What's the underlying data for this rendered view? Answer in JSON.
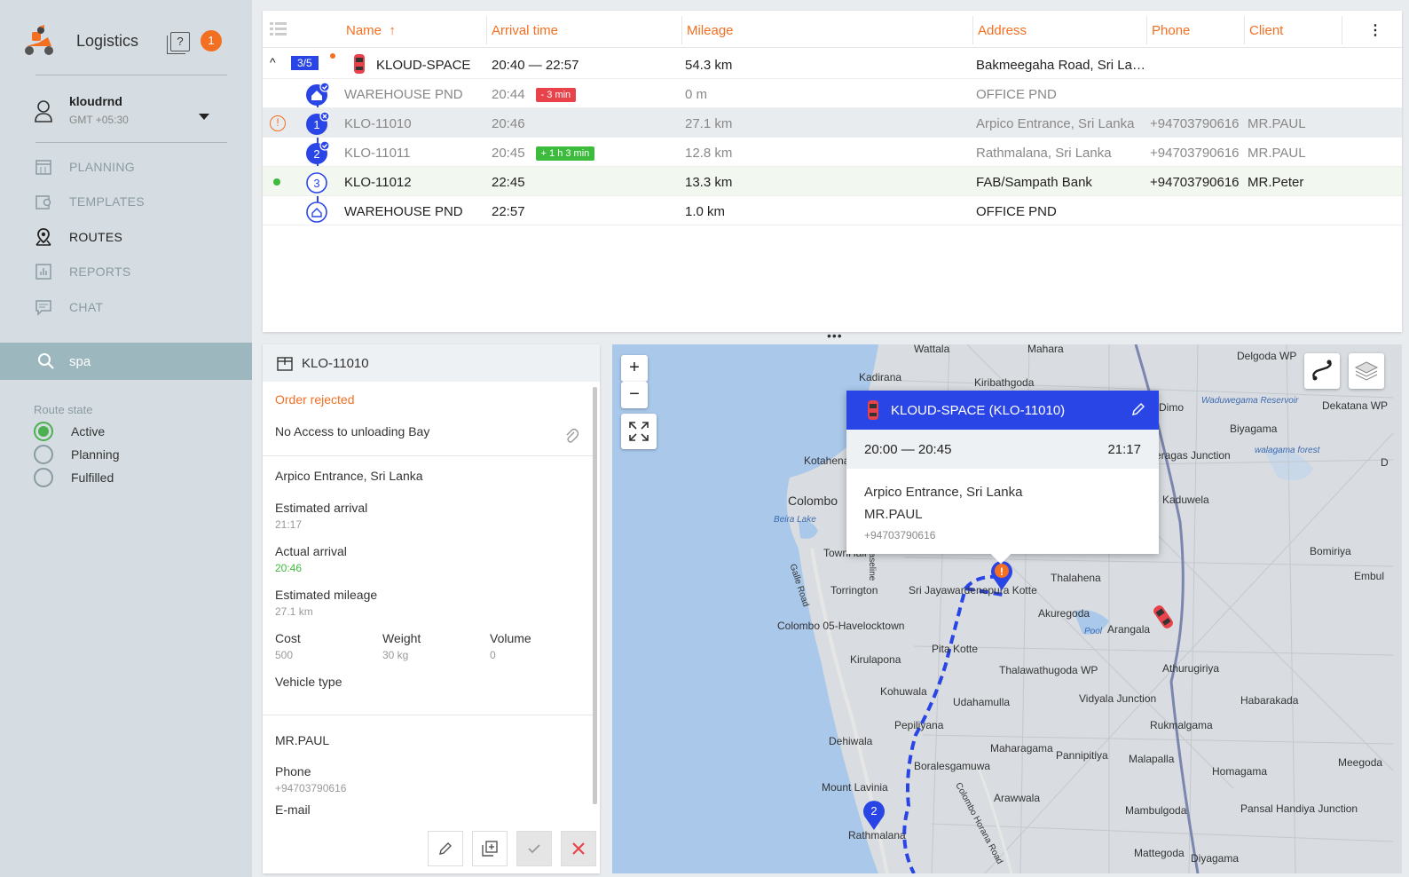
{
  "sidebar": {
    "brand": "Logistics",
    "notifications": "1",
    "help_glyph": "?",
    "user": {
      "name": "kloudrnd",
      "timezone": "GMT +05:30"
    },
    "nav": [
      {
        "label": "PLANNING",
        "icon": "calendar-icon"
      },
      {
        "label": "TEMPLATES",
        "icon": "template-icon"
      },
      {
        "label": "ROUTES",
        "icon": "route-pin-icon",
        "active": true
      },
      {
        "label": "REPORTS",
        "icon": "bar-chart-icon"
      },
      {
        "label": "CHAT",
        "icon": "chat-icon"
      }
    ],
    "search": {
      "value": "spa"
    },
    "route_state": {
      "title": "Route state",
      "options": [
        "Active",
        "Planning",
        "Fulfilled"
      ],
      "selected": "Active"
    }
  },
  "table": {
    "columns": [
      "Name",
      "Arrival time",
      "Mileage",
      "Address",
      "Phone",
      "Client"
    ],
    "sort_indicator": "↑",
    "route": {
      "progress": "3/5",
      "name": "KLOUD-SPACE",
      "arrival": "20:40 — 22:57",
      "mileage": "54.3 km",
      "address": "Bakmeegaha Road, Sri La…"
    },
    "stops": [
      {
        "marker": "home",
        "name": "WAREHOUSE PND",
        "arrival": "20:44",
        "tag": "- 3 min",
        "tag_color": "#e8434b",
        "mileage": "0 m",
        "address": "OFFICE PND",
        "phone": "",
        "client": ""
      },
      {
        "marker": "1",
        "name": "KLO-11010",
        "arrival": "20:46",
        "mileage": "27.1 km",
        "address": "Arpico Entrance, Sri Lanka",
        "phone": "+94703790616",
        "client": "MR.PAUL",
        "warning": "!"
      },
      {
        "marker": "2",
        "name": "KLO-11011",
        "arrival": "20:45",
        "tag": "+ 1 h 3 min",
        "tag_color": "#3dbb3d",
        "mileage": "12.8 km",
        "address": "Rathmalana, Sri Lanka",
        "phone": "+94703790616",
        "client": "MR.PAUL"
      },
      {
        "marker": "3",
        "name": "KLO-11012",
        "arrival": "22:45",
        "mileage": "13.3 km",
        "address": "FAB/Sampath Bank",
        "phone": "+94703790616",
        "client": "MR.Peter"
      },
      {
        "marker": "home-outline",
        "name": "WAREHOUSE PND",
        "arrival": "22:57",
        "mileage": "1.0 km",
        "address": "OFFICE PND",
        "phone": "",
        "client": ""
      }
    ]
  },
  "detail": {
    "order_id": "KLO-11010",
    "status": "Order rejected",
    "reason": "No Access to unloading Bay",
    "address": "Arpico Entrance, Sri Lanka",
    "estimated_arrival": {
      "label": "Estimated arrival",
      "value": "21:17"
    },
    "actual_arrival": {
      "label": "Actual arrival",
      "value": "20:46"
    },
    "estimated_mileage": {
      "label": "Estimated mileage",
      "value": "27.1 km"
    },
    "cost": {
      "label": "Cost",
      "value": "500"
    },
    "weight": {
      "label": "Weight",
      "value": "30 kg"
    },
    "volume": {
      "label": "Volume",
      "value": "0"
    },
    "vehicle_type": {
      "label": "Vehicle type"
    },
    "client": "MR.PAUL",
    "phone": {
      "label": "Phone",
      "value": "+94703790616"
    },
    "email": {
      "label": "E-mail"
    }
  },
  "map": {
    "zoom_in": "+",
    "zoom_out": "−",
    "popup": {
      "title": "KLOUD-SPACE (KLO-11010)",
      "window": "20:00 — 20:45",
      "eta": "21:17",
      "address": "Arpico Entrance, Sri Lanka",
      "client": "MR.PAUL",
      "phone": "+94703790616"
    },
    "markers": {
      "warn": "!",
      "stop2": "2"
    },
    "labels": [
      "Wattala",
      "Mahara",
      "Kadirana",
      "Kiribathgoda",
      "Delgoda WP",
      "Dimo",
      "Waduwegama Reservoir",
      "Dekatana WP",
      "Biyagama",
      "Kotahena",
      "Peragas Junction",
      "walagama forest",
      "D",
      "Colombo",
      "Beira Lake",
      "Kaduwela",
      "TownHall",
      "Torrington",
      "Sri Jayawardenepura Kotte",
      "Thalahena",
      "Bomiriya",
      "Embul",
      "Akuregoda",
      "Colombo 05-Havelocktown",
      "Pool",
      "Arangala",
      "Pita Kotte",
      "Kirulapona",
      "Thalawathugoda WP",
      "Athurugiriya",
      "Kohuwala",
      "Udahamulla",
      "Vidyala Junction",
      "Habarakada",
      "Pepiliyana",
      "Rukmalgama",
      "Dehiwala",
      "Maharagama",
      "Pannipitiya",
      "Malapalla",
      "Meegoda",
      "Boralesgamuwa",
      "Homagama",
      "Mount Lavinia",
      "Arawwala",
      "Mambulgoda",
      "Pansal Handiya Junction",
      "Rathmalana",
      "Mattegoda",
      "Diyagama",
      "Galle Road",
      "Colombo Horana Road",
      "Baseline"
    ]
  },
  "colors": {
    "accent": "#f36f21",
    "route_blue": "#2a45e6",
    "active_green": "#4caf50"
  }
}
